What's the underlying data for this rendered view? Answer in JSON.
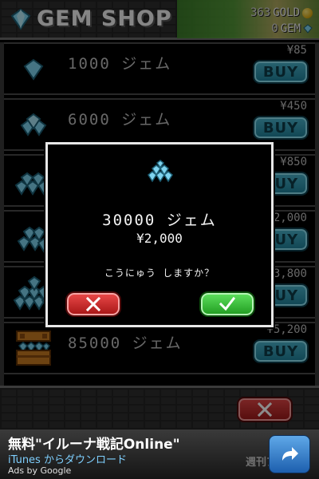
{
  "header": {
    "title": "GEM SHOP",
    "gold_amount": "363",
    "gold_label": "GOLD",
    "gem_amount": "0",
    "gem_label": "GEM"
  },
  "shop_items": [
    {
      "amount": "1000 ジェム",
      "price": "¥85",
      "buy_label": "BUY"
    },
    {
      "amount": "6000 ジェム",
      "price": "¥450",
      "buy_label": "BUY"
    },
    {
      "amount": "",
      "price": "¥850",
      "buy_label": "BUY"
    },
    {
      "amount": "",
      "price": "2,000",
      "buy_label": "BUY"
    },
    {
      "amount": "",
      "price": "3,800",
      "buy_label": "BUY"
    },
    {
      "amount": "85000 ジェム",
      "price": "¥5,200",
      "buy_label": "BUY"
    }
  ],
  "dialog": {
    "amount": "30000 ジェム",
    "price": "¥2,000",
    "question": "こうにゅう しますか？"
  },
  "ad": {
    "title": "無料\"イルーナ戦記Online\"",
    "subtitle": "iTunes からダウンロード",
    "by": "Ads by Google",
    "watermark": "週刊ア"
  },
  "colors": {
    "buy_button": "#2a96b0",
    "cancel_button": "#c42020",
    "confirm_button": "#2fbf2f",
    "gem": "#7fd3ee"
  }
}
